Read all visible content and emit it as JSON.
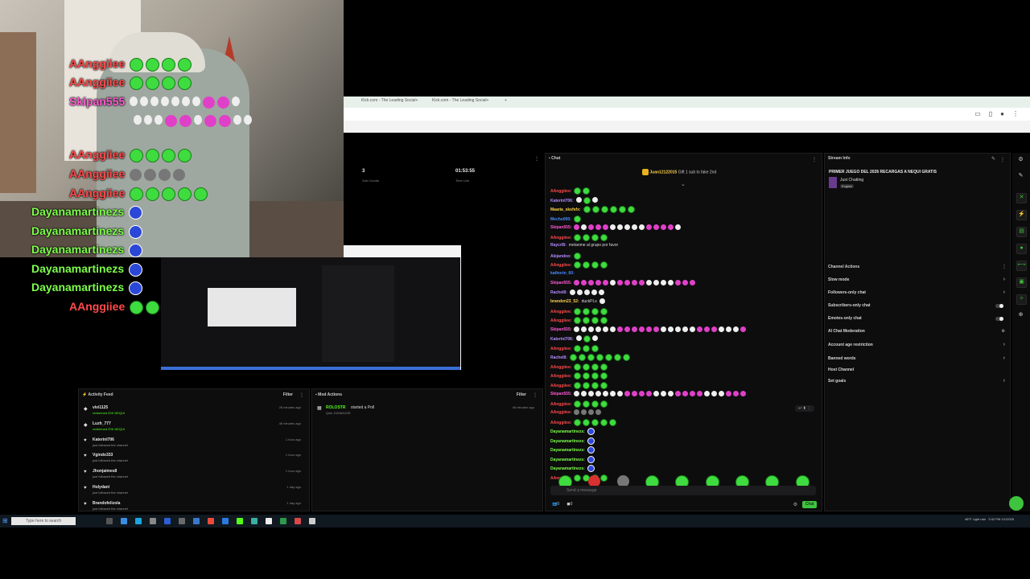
{
  "overlay_chat": [
    {
      "name": "AAnggiiee",
      "color": "#ff4a4a",
      "emotes": [
        "g",
        "g",
        "g",
        "g"
      ]
    },
    {
      "name": "AAnggiiee",
      "color": "#ff4a4a",
      "emotes": [
        "g",
        "g",
        "g",
        "g"
      ]
    },
    {
      "name": "Skipan555",
      "color": "#ff5ad2",
      "emotes": [
        "w",
        "w",
        "w",
        "w",
        "w",
        "w",
        "w",
        "p",
        "p",
        "w"
      ]
    },
    {
      "name": "",
      "color": "#ff5ad2",
      "emotes": [
        "w",
        "w",
        "w",
        "p",
        "p",
        "w",
        "p",
        "p",
        "w",
        "w"
      ]
    },
    {
      "name": "AAnggiiee",
      "color": "#ff4a4a",
      "emotes": [
        "g",
        "g",
        "g",
        "g"
      ]
    },
    {
      "name": "AAnggiiee",
      "color": "#ff4a4a",
      "emotes": [
        "gr",
        "gr",
        "gr",
        "gr"
      ]
    },
    {
      "name": "AAnggiiee",
      "color": "#ff4a4a",
      "emotes": [
        "g",
        "g",
        "g",
        "g",
        "g"
      ]
    },
    {
      "name": "Dayanamartinezs",
      "color": "#7dff4a",
      "emotes": [
        "b"
      ]
    },
    {
      "name": "Dayanamartinezs",
      "color": "#7dff4a",
      "emotes": [
        "b"
      ]
    },
    {
      "name": "Dayanamartinezs",
      "color": "#7dff4a",
      "emotes": [
        "b"
      ]
    },
    {
      "name": "Dayanamartinezs",
      "color": "#7dff4a",
      "emotes": [
        "b"
      ]
    },
    {
      "name": "Dayanamartinezs",
      "color": "#7dff4a",
      "emotes": [
        "b"
      ]
    },
    {
      "name": "AAnggiiee",
      "color": "#ff4a4a",
      "emotes": [
        "g",
        "g",
        "g",
        "g"
      ]
    }
  ],
  "browser": {
    "tabs": [
      "Kick.com - The Leading Social+",
      "Kick.com - The Leading Social+"
    ],
    "new_tab": "+"
  },
  "stats": {
    "sub_counts_value": "3",
    "sub_counts_label": "Sub Counts",
    "time_live_value": "01:53:55",
    "time_live_label": "Time Live"
  },
  "chat": {
    "title": "Chat",
    "pinned_user": "Juan12122015",
    "pinned_text": "Gift 1 sub to fake 2nd",
    "messages": [
      {
        "name": "AAnggiiee:",
        "color": "#ff4a4a",
        "text": "",
        "emotes": [
          "g",
          "g"
        ]
      },
      {
        "name": "KaterinI706:",
        "color": "#b48cff",
        "text": "",
        "emotes": [
          "w",
          "g",
          "w"
        ]
      },
      {
        "name": "Maaria_sksfsfx:",
        "color": "#ffd34a",
        "text": "",
        "emotes": [
          "g",
          "g",
          "g",
          "g",
          "g",
          "g"
        ]
      },
      {
        "name": "Mechu000:",
        "color": "#4a8cff",
        "text": "",
        "emotes": [
          "g"
        ]
      },
      {
        "name": "Skipan555:",
        "color": "#ff5ad2",
        "text": "",
        "emotes": [
          "p",
          "w",
          "p",
          "p",
          "p",
          "w",
          "w",
          "w",
          "w",
          "w",
          "p",
          "p",
          "p",
          "p",
          "w"
        ]
      },
      {
        "name": "AAnggiiee:",
        "color": "#ff4a4a",
        "text": "",
        "emotes": [
          "g",
          "g",
          "g",
          "g"
        ]
      },
      {
        "name": "Raycrl8:",
        "color": "#b48cff",
        "text": "metanme al grupo por favor",
        "emotes": []
      },
      {
        "name": "Alejandoo:",
        "color": "#b48cff",
        "text": "",
        "emotes": [
          "g"
        ]
      },
      {
        "name": "AAnggiiee:",
        "color": "#ff4a4a",
        "text": "",
        "emotes": [
          "g",
          "g",
          "g",
          "g"
        ]
      },
      {
        "name": "kathorin_60:",
        "color": "#4a8cff",
        "text": "",
        "emotes": []
      },
      {
        "name": "Skipan555:",
        "color": "#ff5ad2",
        "text": "",
        "emotes": [
          "p",
          "p",
          "p",
          "p",
          "p",
          "w",
          "p",
          "p",
          "p",
          "p",
          "w",
          "w",
          "w",
          "w",
          "p",
          "p",
          "p"
        ]
      },
      {
        "name": "Rachel8:",
        "color": "#b48cff",
        "text": "",
        "emotes": [
          "w",
          "w",
          "w",
          "w",
          "w"
        ]
      },
      {
        "name": "brandon23_52:",
        "color": "#ffd34a",
        "text": "duckPLs",
        "emotes": [
          "w"
        ]
      },
      {
        "name": "AAnggiiee:",
        "color": "#ff4a4a",
        "text": "",
        "emotes": [
          "g",
          "g",
          "g",
          "g"
        ]
      },
      {
        "name": "AAnggiiee:",
        "color": "#ff4a4a",
        "text": "",
        "emotes": [
          "g",
          "g",
          "g",
          "g"
        ]
      },
      {
        "name": "Skipan555:",
        "color": "#ff5ad2",
        "text": "",
        "emotes": [
          "w",
          "w",
          "w",
          "w",
          "w",
          "w",
          "p",
          "p",
          "p",
          "p",
          "p",
          "p",
          "w",
          "w",
          "w",
          "w",
          "w",
          "p",
          "p",
          "p",
          "w",
          "w",
          "w",
          "p"
        ]
      },
      {
        "name": "KaterinI706:",
        "color": "#b48cff",
        "text": "",
        "emotes": [
          "w",
          "g",
          "w"
        ]
      },
      {
        "name": "AAnggiiee:",
        "color": "#ff4a4a",
        "text": "",
        "emotes": [
          "g",
          "g",
          "g"
        ]
      },
      {
        "name": "Rachel8:",
        "color": "#b48cff",
        "text": "",
        "emotes": [
          "g",
          "g",
          "g",
          "g",
          "g",
          "g",
          "g"
        ]
      },
      {
        "name": "AAnggiiee:",
        "color": "#ff4a4a",
        "text": "",
        "emotes": [
          "g",
          "g",
          "g",
          "g"
        ]
      },
      {
        "name": "AAnggiiee:",
        "color": "#ff4a4a",
        "text": "",
        "emotes": [
          "g",
          "g",
          "g",
          "g"
        ]
      },
      {
        "name": "AAnggiiee:",
        "color": "#ff4a4a",
        "text": "",
        "emotes": [
          "g",
          "g",
          "g",
          "g"
        ]
      },
      {
        "name": "Skipan555:",
        "color": "#ff5ad2",
        "text": "",
        "emotes": [
          "w",
          "w",
          "w",
          "w",
          "w",
          "w",
          "w",
          "p",
          "p",
          "p",
          "p",
          "w",
          "w",
          "w",
          "p",
          "p",
          "p",
          "p",
          "w",
          "w",
          "w",
          "p",
          "p",
          "p"
        ]
      },
      {
        "name": "AAnggiiee:",
        "color": "#ff4a4a",
        "text": "",
        "emotes": [
          "g",
          "g",
          "g",
          "g"
        ]
      },
      {
        "name": "AAnggiiee:",
        "color": "#ff4a4a",
        "text": "",
        "emotes": [
          "gr",
          "gr",
          "gr",
          "gr"
        ]
      },
      {
        "name": "AAnggiiee:",
        "color": "#ff4a4a",
        "text": "",
        "emotes": [
          "g",
          "g",
          "g",
          "g",
          "g"
        ]
      },
      {
        "name": "Dayanamartinezs:",
        "color": "#7dff4a",
        "text": "",
        "emotes": [
          "b"
        ]
      },
      {
        "name": "Dayanamartinezs:",
        "color": "#7dff4a",
        "text": "",
        "emotes": [
          "b"
        ]
      },
      {
        "name": "Dayanamartinezs:",
        "color": "#7dff4a",
        "text": "",
        "emotes": [
          "b"
        ]
      },
      {
        "name": "Dayanamartinezs:",
        "color": "#7dff4a",
        "text": "",
        "emotes": [
          "b"
        ]
      },
      {
        "name": "Dayanamartinezs:",
        "color": "#7dff4a",
        "text": "",
        "emotes": [
          "b"
        ]
      },
      {
        "name": "AAnggiiee:",
        "color": "#ff4a4a",
        "text": "",
        "emotes": [
          "g",
          "g",
          "g",
          "g"
        ]
      }
    ],
    "input_placeholder": "Send a message",
    "send_label": "Chat",
    "viewer_count": "0",
    "points": "0"
  },
  "stream_info": {
    "title": "Stream Info",
    "stream_title": "PRIMER JUEGO DEL 2026 RECARGAS A NEQUI GRATIS",
    "category": "Just Chatting",
    "language": "English"
  },
  "channel_actions": {
    "title": "Channel Actions",
    "items": [
      {
        "label": "Slow mode",
        "control": "chevron"
      },
      {
        "label": "Followers-only chat",
        "control": "chevron"
      },
      {
        "label": "Subscribers-only chat",
        "control": "toggle"
      },
      {
        "label": "Emotes-only chat",
        "control": "toggle"
      },
      {
        "label": "AI Chat Moderation",
        "control": "icon"
      },
      {
        "label": "Account age restriction",
        "control": "chevron"
      },
      {
        "label": "Banned words",
        "control": "chevron"
      },
      {
        "label": "Host Channel",
        "control": "none"
      },
      {
        "label": "Set goals",
        "control": "chevron"
      }
    ]
  },
  "activity_feed": {
    "title": "Activity Feed",
    "filter_label": "Filter",
    "items": [
      {
        "who": "vivi1125",
        "what": "redeemed 20K NEQUI",
        "when": "28 minutes ago",
        "icon": "gift-icon"
      },
      {
        "who": "Luzh_777",
        "what": "redeemed 20K NEQUI",
        "when": "46 minutes ago",
        "icon": "gift-icon"
      },
      {
        "who": "KaterinI706",
        "what": "just followed the channel",
        "when": "1 hour ago",
        "icon": "heart-icon"
      },
      {
        "who": "Vgindo333",
        "what": "just followed the channel",
        "when": "1 hour ago",
        "icon": "heart-icon"
      },
      {
        "who": "Jhonjaimes8",
        "what": "just followed the channel",
        "when": "1 hour ago",
        "icon": "heart-icon"
      },
      {
        "who": "Holydani",
        "what": "just followed the channel",
        "when": "1 day ago",
        "icon": "heart-icon"
      },
      {
        "who": "Brandofelizola",
        "what": "just followed the channel",
        "when": "1 day ago",
        "icon": "heart-icon"
      }
    ]
  },
  "mod_actions": {
    "title": "Mod Actions",
    "filter_label": "Filter",
    "items": [
      {
        "who": "ROLOSTR",
        "what": "started a Poll",
        "sub": "Quik JUMANJOE",
        "when": "46 minutes ago"
      }
    ]
  },
  "taskbar": {
    "search_placeholder": "Type here to search",
    "weather": "48°F Light rain",
    "time": "3:42 PM",
    "date": "1/1/2026"
  },
  "colors": {
    "accent": "#53fc18",
    "panel": "#0d0d0e"
  }
}
